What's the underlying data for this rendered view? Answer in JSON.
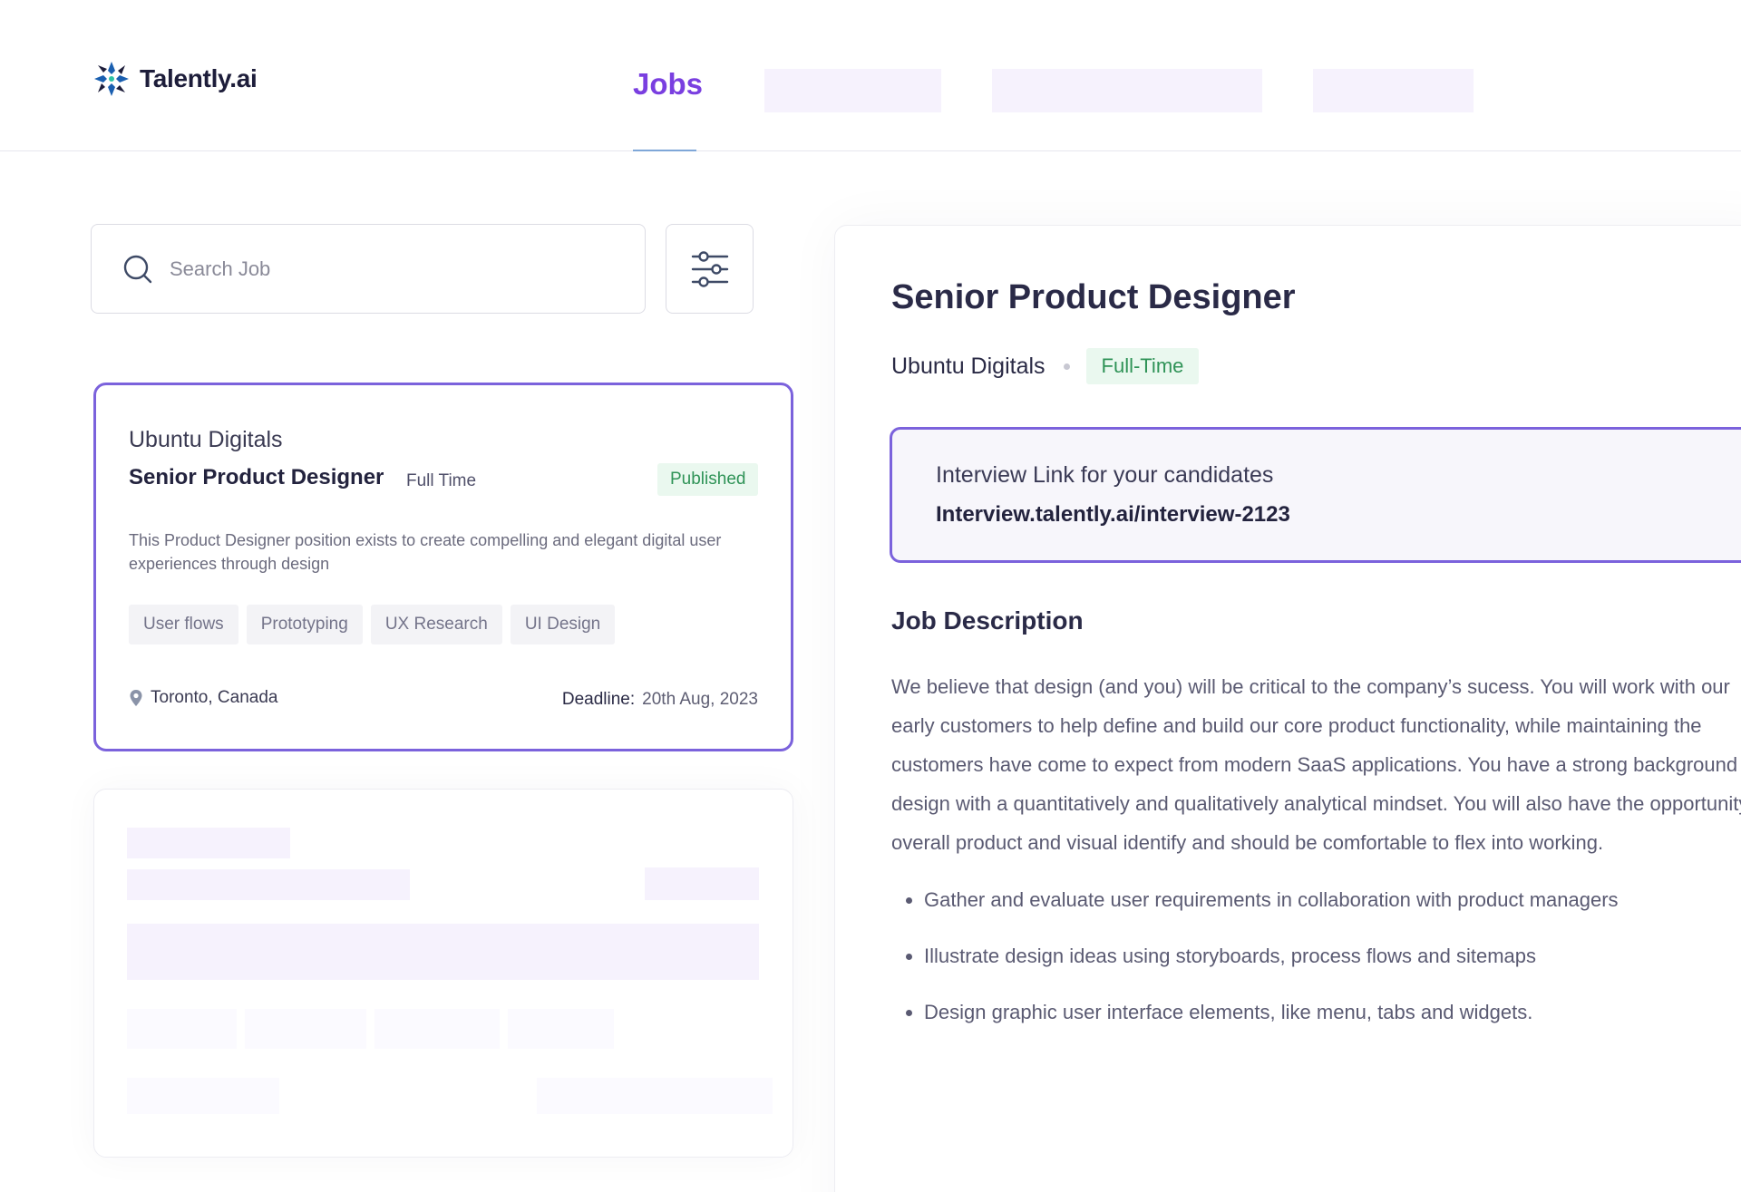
{
  "header": {
    "logo_text": "Talently.ai",
    "nav_active_label": "Jobs"
  },
  "search": {
    "placeholder": "Search Job"
  },
  "job_card": {
    "company": "Ubuntu Digitals",
    "title": "Senior Product Designer",
    "type": "Full Time",
    "status": "Published",
    "description": "This Product Designer position exists to create compelling and elegant digital user experiences through design",
    "tags": [
      "User flows",
      "Prototyping",
      "UX Research",
      "UI Design"
    ],
    "location": "Toronto, Canada",
    "deadline_label": "Deadline:",
    "deadline_value": "20th Aug, 2023"
  },
  "detail": {
    "title": "Senior Product Designer",
    "company": "Ubuntu Digitals",
    "type": "Full-Time",
    "interview_label": "Interview Link for your candidates",
    "interview_url": "Interview.talently.ai/interview-2123",
    "section_title": "Job Description",
    "body_lines": [
      "We believe that design (and you) will be critical to the company’s sucess. You will work with our",
      "early customers to help define and build our core product functionality, while maintaining the",
      "customers have come to expect from modern SaaS applications. You have a strong background",
      "design with a quantitatively and qualitatively analytical mindset. You will also have the opportunity",
      "overall product and visual identify and should be comfortable to flex into working."
    ],
    "bullets": [
      "Gather and evaluate user requirements in collaboration with product managers",
      "Illustrate design ideas using storyboards, process flows and sitemaps",
      "Design graphic user interface elements, like menu, tabs and widgets."
    ]
  },
  "colors": {
    "brand": "#7a3fe0",
    "card_border": "#7b62dc",
    "status_green": "#2f9357",
    "placeholder_fill": "#f6f2fd"
  }
}
